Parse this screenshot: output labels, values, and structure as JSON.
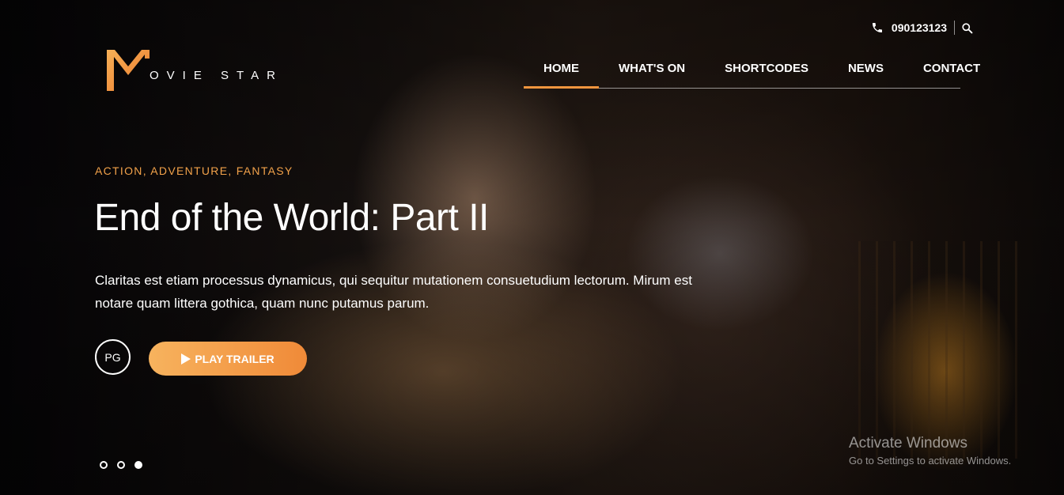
{
  "brand": {
    "logo_text": "OVIE STAR",
    "accent_color": "#f0953e"
  },
  "topbar": {
    "phone_icon": "phone-icon",
    "phone_number": "090123123",
    "search_icon": "search-icon"
  },
  "nav": {
    "items": [
      {
        "label": "HOME",
        "active": true
      },
      {
        "label": "WHAT'S ON",
        "active": false
      },
      {
        "label": "SHORTCODES",
        "active": false
      },
      {
        "label": "NEWS",
        "active": false
      },
      {
        "label": "CONTACT",
        "active": false
      }
    ]
  },
  "hero": {
    "genres": "ACTION, ADVENTURE, FANTASY",
    "title": "End of the World: Part II",
    "description": "Claritas est etiam processus dynamicus, qui sequitur mutationem consuetudium lectorum. Mirum est notare quam littera gothica, quam nunc putamus parum.",
    "rating": "PG",
    "trailer_button": "PLAY TRAILER",
    "play_icon": "play-icon",
    "slides": {
      "count": 3,
      "active_index": 2
    }
  },
  "watermark": {
    "title": "Activate Windows",
    "subtitle": "Go to Settings to activate Windows."
  }
}
